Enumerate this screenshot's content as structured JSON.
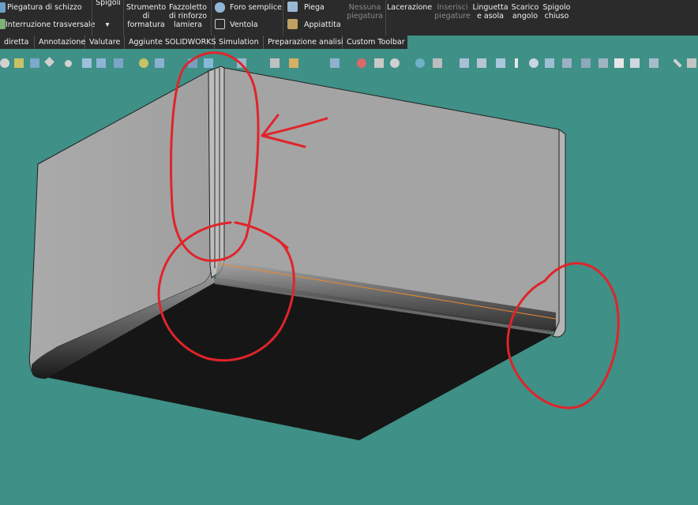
{
  "ribbon": {
    "piegatura_schizzo": "Piegatura di schizzo",
    "interruzione_trasversale": "Interruzione trasversale",
    "spigoli": "Spigoli",
    "spigoli_arrow": "▾",
    "strumento_formatura": [
      "Strumento",
      "di",
      "formatura"
    ],
    "fazzoletto": [
      "Fazzoletto",
      "di rinforzo",
      "lamiera"
    ],
    "foro_semplice": "Foro semplice",
    "ventola": "Ventola",
    "piega": "Piega",
    "appiattita": "Appiattita",
    "nessuna_piegatura": [
      "Nessuna",
      "piegatura"
    ],
    "lacerazione": "Lacerazione",
    "inserisci_piegature": [
      "Inserisci",
      "piegature"
    ],
    "linguetta_asola": [
      "Linguetta",
      "e asola"
    ],
    "scarico_angolo": [
      "Scarico",
      "angolo"
    ],
    "spigolo_chiuso": [
      "Spigolo",
      "chiuso"
    ]
  },
  "tabs": [
    "diretta",
    "Annotazione",
    "Valutare",
    "Aggiunte SOLIDWORKS",
    "Simulation",
    "Preparazione analisi",
    "Custom Toolbar"
  ],
  "colors": {
    "background": "#3f9087",
    "ribbon": "#2b2b2b",
    "face_light": "#a3a3a3",
    "face_shadow": "#161616",
    "annotation": "#e0242a",
    "selected_edge": "#e88a2a"
  },
  "icons": [
    "view-orientation-icon",
    "section-view-icon",
    "display-style-icon",
    "hide-show-icon",
    "appearance-icon",
    "scene-icon",
    "view-setting-icon",
    "measure-icon",
    "sum-icon"
  ]
}
